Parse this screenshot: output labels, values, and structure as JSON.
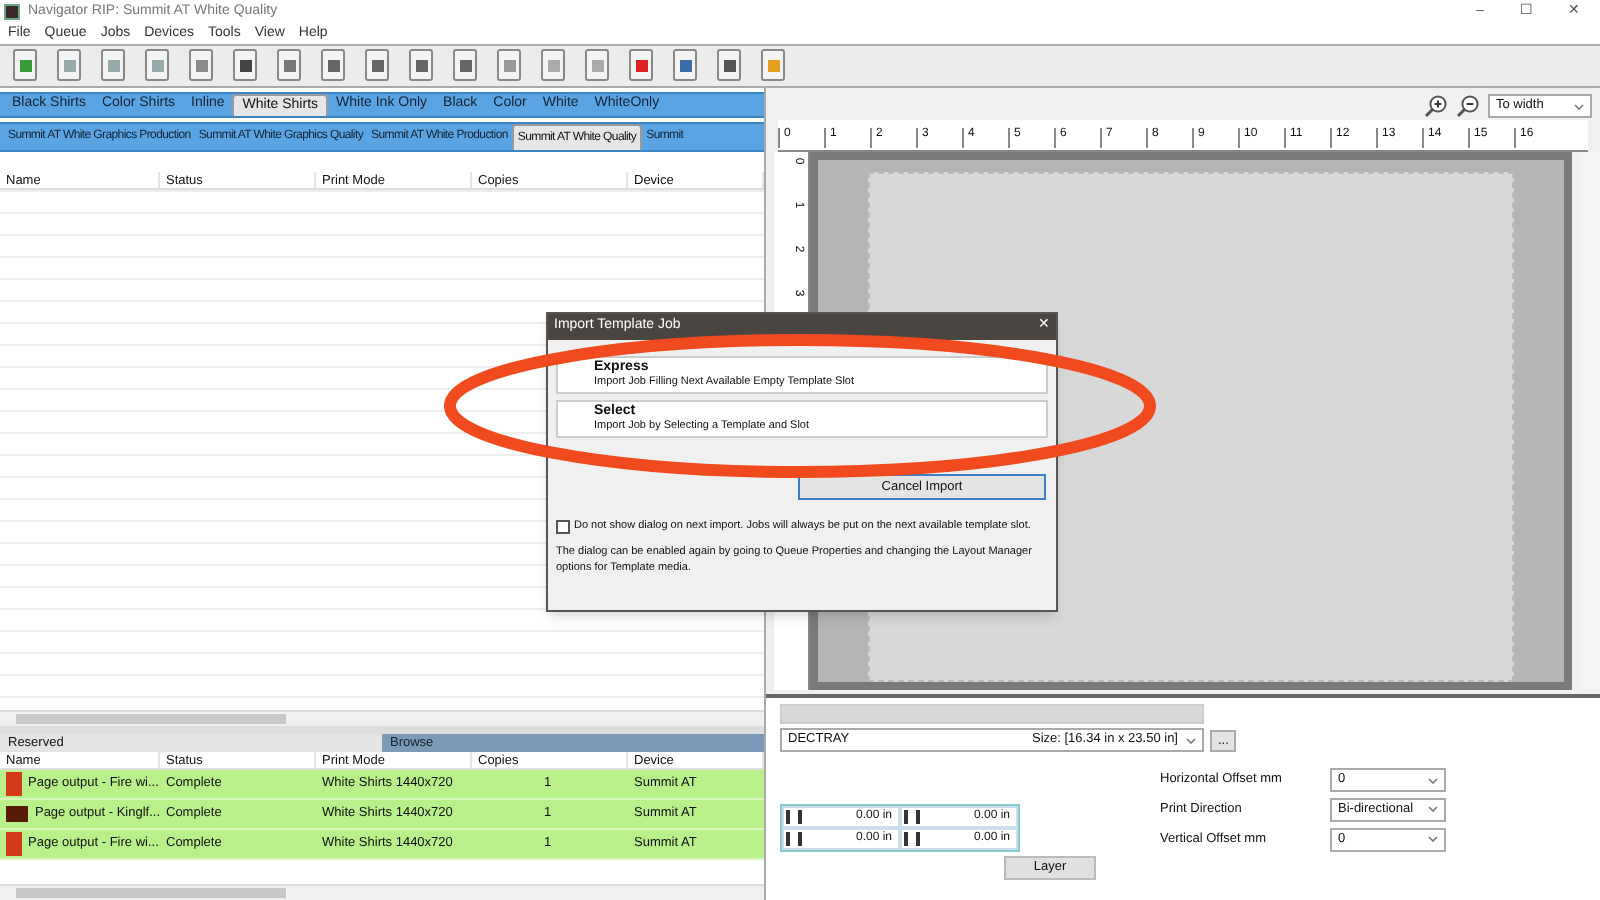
{
  "window": {
    "title": "Navigator RIP: Summit AT White Quality"
  },
  "menu": [
    "File",
    "Queue",
    "Jobs",
    "Devices",
    "Tools",
    "View",
    "Help"
  ],
  "queue_tabs": [
    {
      "label": "Black Shirts",
      "selected": false
    },
    {
      "label": "Color Shirts",
      "selected": false
    },
    {
      "label": "Inline",
      "selected": false
    },
    {
      "label": "White Shirts",
      "selected": true
    },
    {
      "label": "White Ink Only",
      "selected": false
    },
    {
      "label": "Black",
      "selected": false
    },
    {
      "label": "Color",
      "selected": false
    },
    {
      "label": "White",
      "selected": false
    },
    {
      "label": "WhiteOnly",
      "selected": false
    }
  ],
  "printer_tabs": [
    {
      "label": "Summit AT White Graphics Production",
      "selected": false
    },
    {
      "label": "Summit AT White Graphics Quality",
      "selected": false
    },
    {
      "label": "Summit AT White Production",
      "selected": false
    },
    {
      "label": "Summit AT White Quality",
      "selected": true
    },
    {
      "label": "Summit",
      "selected": false
    }
  ],
  "queue_table": {
    "columns": [
      "Name",
      "Status",
      "Print Mode",
      "Copies",
      "Device"
    ]
  },
  "bottom_tabs": [
    {
      "label": "Reserved",
      "selected": false
    },
    {
      "label": "Browse",
      "selected": true
    }
  ],
  "jobs_table": {
    "columns": [
      "Name",
      "Status",
      "Print Mode",
      "Copies",
      "Device"
    ],
    "rows": [
      {
        "name": "Page output - Fire wi...",
        "status": "Complete",
        "print_mode": "White Shirts 1440x720",
        "copies": "1",
        "device": "Summit AT"
      },
      {
        "name": "Page output - Kinglf...",
        "status": "Complete",
        "print_mode": "White Shirts 1440x720",
        "copies": "1",
        "device": "Summit AT"
      },
      {
        "name": "Page output - Fire wi...",
        "status": "Complete",
        "print_mode": "White Shirts 1440x720",
        "copies": "1",
        "device": "Summit AT"
      }
    ]
  },
  "preview": {
    "zoom": "To width",
    "ruler_h": [
      "0",
      "1",
      "2",
      "3",
      "4",
      "5",
      "6",
      "7",
      "8",
      "9",
      "10",
      "11",
      "12",
      "13",
      "14",
      "15",
      "16"
    ],
    "ruler_v": [
      "0",
      "1",
      "2",
      "3"
    ]
  },
  "layout_panel": {
    "tray": "DECTRAY",
    "size": "Size: [16.34 in x 23.50 in]",
    "more_button": "...",
    "margins": [
      "0.00 in",
      "0.00 in",
      "0.00 in",
      "0.00 in"
    ],
    "settings": [
      {
        "label": "Horizontal Offset mm",
        "value": "0"
      },
      {
        "label": "Print Direction",
        "value": "Bi-directional"
      },
      {
        "label": "Vertical Offset mm",
        "value": "0"
      }
    ],
    "layer_button": "Layer"
  },
  "dialog": {
    "title": "Import Template Job",
    "close": "✕",
    "options": [
      {
        "title": "Express",
        "description": "Import Job Filling Next Available Empty Template Slot"
      },
      {
        "title": "Select",
        "description": "Import Job by Selecting a Template and Slot"
      }
    ],
    "cancel_button": "Cancel Import",
    "checkbox": {
      "label": "Do not show dialog on next import. Jobs will always be put on the next available template slot.",
      "checked": false
    },
    "note": "The dialog can be enabled again by going to Queue Properties and changing the Layout Manager options for Template media."
  },
  "window_controls": [
    "–",
    "☐",
    "✕"
  ]
}
